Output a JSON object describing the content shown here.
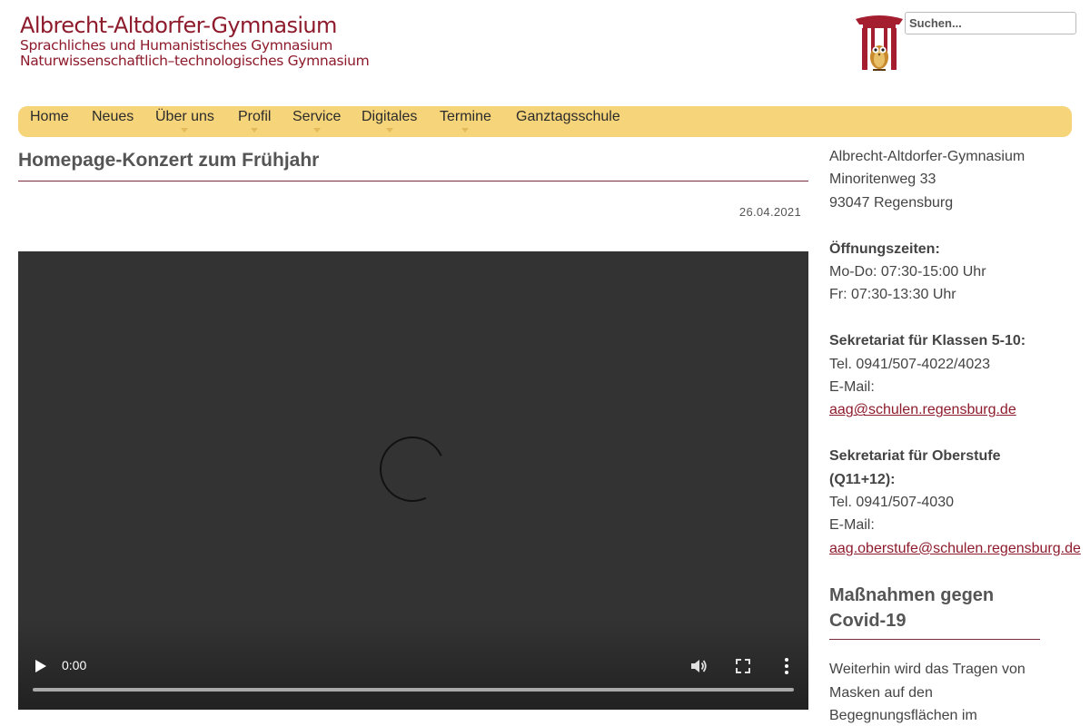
{
  "header": {
    "logo_title": "Albrecht-Altdorfer-Gymnasium",
    "logo_sub1": "Sprachliches und Humanistisches Gymnasium",
    "logo_sub2": "Naturwissenschaftlich–technologisches Gymnasium",
    "crest_icon": "owl-crest-icon",
    "search_placeholder": "Suchen..."
  },
  "nav": {
    "items": [
      {
        "label": "Home",
        "has_submenu": false
      },
      {
        "label": "Neues",
        "has_submenu": false
      },
      {
        "label": "Über uns",
        "has_submenu": true
      },
      {
        "label": "Profil",
        "has_submenu": true
      },
      {
        "label": "Service",
        "has_submenu": true
      },
      {
        "label": "Digitales",
        "has_submenu": true
      },
      {
        "label": "Termine",
        "has_submenu": true
      },
      {
        "label": "Ganztagsschule",
        "has_submenu": false
      }
    ],
    "background": "#f6d47a"
  },
  "article": {
    "title": "Homepage-Konzert zum Frühjahr",
    "date": "26.04.2021",
    "video": {
      "current_time": "0:00",
      "progress": 0
    }
  },
  "sidebar": {
    "school": "Albrecht-Altdorfer-Gymnasium",
    "street": "Minoritenweg 33",
    "city": "93047 Regensburg",
    "hours_label": "Öffnungszeiten:",
    "hours_mo_do": "Mo-Do: 07:30-15:00 Uhr",
    "hours_fr": "Fr: 07:30-13:30 Uhr",
    "sek1_label": "Sekretariat für Klassen 5-10:",
    "sek1_tel": "Tel. 0941/507-4022/4023",
    "sek1_email_label": "E-Mail:",
    "sek1_email": "aag@schulen.regensburg.de",
    "sek2_label_line1": "Sekretariat für Oberstufe",
    "sek2_label_line2": "(Q11+12):",
    "sek2_tel": "Tel. 0941/507-4030",
    "sek2_email_label": "E-Mail:",
    "sek2_email": "aag.oberstufe@schulen.regensburg.de",
    "covid_title_line1": "Maßnahmen gegen",
    "covid_title_line2": "Covid-19",
    "covid_text_line1": "Weiterhin wird das Tragen von",
    "covid_text_line2": "Masken auf den",
    "covid_text_line3": "Begegnungsflächen im"
  },
  "colors": {
    "brand": "#8e1b2c",
    "nav": "#f6d47a",
    "video_bg": "#333333"
  }
}
